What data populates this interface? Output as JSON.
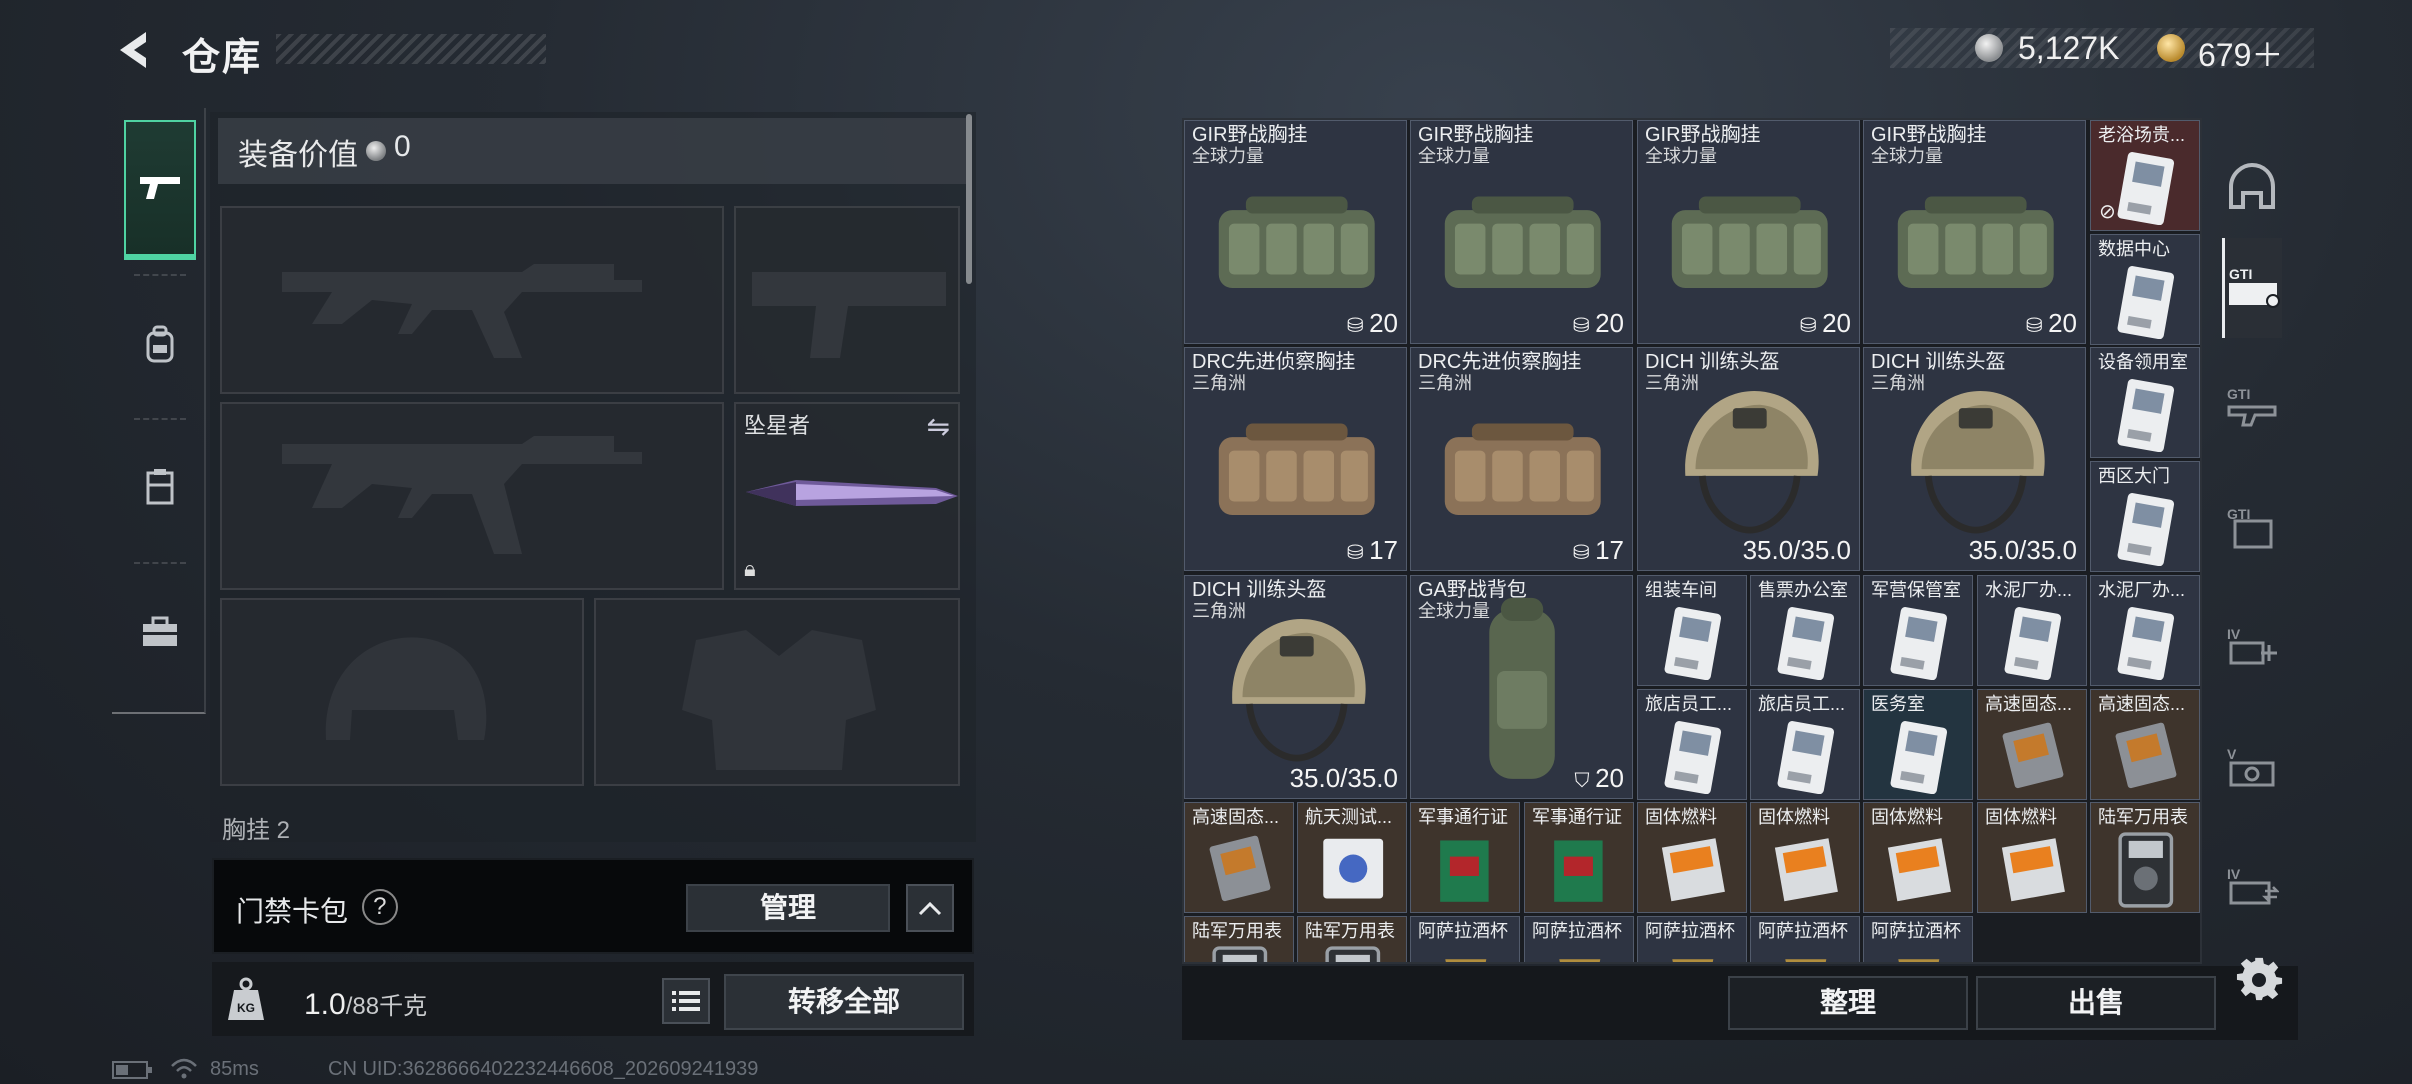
{
  "header": {
    "title": "仓库",
    "silver": "5,127K",
    "gold": "679＋"
  },
  "equipment": {
    "title": "装备价值",
    "value": "0",
    "melee_label": "坠星者",
    "next_section_label": "胸挂",
    "next_section_count": "2"
  },
  "card_pack": {
    "label": "门禁卡包",
    "help": "?",
    "manage_label": "管理"
  },
  "weight": {
    "current": "1.0",
    "max": "/88千克",
    "transfer_label": "转移全部"
  },
  "status": {
    "ping": "85ms",
    "uid": "CN UID:3628666402232446608_202609241939"
  },
  "storage": {
    "items": [
      {
        "name": "GIR野战胸挂",
        "sub": "全球力量",
        "count": "20",
        "count_icon": "vest",
        "art": "rig-green"
      },
      {
        "name": "GIR野战胸挂",
        "sub": "全球力量",
        "count": "20",
        "count_icon": "vest",
        "art": "rig-green"
      },
      {
        "name": "GIR野战胸挂",
        "sub": "全球力量",
        "count": "20",
        "count_icon": "vest",
        "art": "rig-green"
      },
      {
        "name": "GIR野战胸挂",
        "sub": "全球力量",
        "count": "20",
        "count_icon": "vest",
        "art": "rig-green"
      },
      {
        "name": "老浴场贵...",
        "sub": "",
        "count": "",
        "art": "card-red"
      },
      {
        "name": "数据中心",
        "sub": "",
        "count": "",
        "art": "card"
      },
      {
        "name": "DRC先进侦察胸挂",
        "sub": "三角洲",
        "count": "17",
        "count_icon": "vest",
        "art": "rig-tan"
      },
      {
        "name": "DRC先进侦察胸挂",
        "sub": "三角洲",
        "count": "17",
        "count_icon": "vest",
        "art": "rig-tan"
      },
      {
        "name": "DICH 训练头盔",
        "sub": "三角洲",
        "count": "35.0/35.0",
        "art": "helmet"
      },
      {
        "name": "DICH 训练头盔",
        "sub": "三角洲",
        "count": "35.0/35.0",
        "art": "helmet"
      },
      {
        "name": "设备领用室",
        "sub": "",
        "count": "",
        "art": "card"
      },
      {
        "name": "西区大门",
        "sub": "",
        "count": "",
        "art": "card"
      },
      {
        "name": "DICH 训练头盔",
        "sub": "三角洲",
        "count": "35.0/35.0",
        "art": "helmet"
      },
      {
        "name": "GA野战背包",
        "sub": "全球力量",
        "count": "20",
        "count_icon": "bag",
        "art": "backpack"
      },
      {
        "name": "组装车间",
        "sub": "",
        "count": "",
        "art": "card"
      },
      {
        "name": "售票办公室",
        "sub": "",
        "count": "",
        "art": "card"
      },
      {
        "name": "军营保管室",
        "sub": "",
        "count": "",
        "art": "card"
      },
      {
        "name": "水泥厂办...",
        "sub": "",
        "count": "",
        "art": "card"
      },
      {
        "name": "水泥厂办...",
        "sub": "",
        "count": "",
        "art": "card"
      },
      {
        "name": "旅店员工...",
        "sub": "",
        "count": "",
        "art": "card"
      },
      {
        "name": "旅店员工...",
        "sub": "",
        "count": "",
        "art": "card"
      },
      {
        "name": "医务室",
        "sub": "",
        "count": "",
        "art": "card-teal"
      },
      {
        "name": "高速固态...",
        "sub": "",
        "count": "",
        "art": "ssd"
      },
      {
        "name": "高速固态...",
        "sub": "",
        "count": "",
        "art": "ssd"
      },
      {
        "name": "高速固态...",
        "sub": "",
        "count": "",
        "art": "ssd"
      },
      {
        "name": "航天测试...",
        "sub": "",
        "count": "",
        "art": "disk"
      },
      {
        "name": "军事通行证",
        "sub": "",
        "count": "",
        "art": "pass"
      },
      {
        "name": "军事通行证",
        "sub": "",
        "count": "",
        "art": "pass"
      },
      {
        "name": "固体燃料",
        "sub": "",
        "count": "",
        "art": "fuel"
      },
      {
        "name": "固体燃料",
        "sub": "",
        "count": "",
        "art": "fuel"
      },
      {
        "name": "固体燃料",
        "sub": "",
        "count": "",
        "art": "fuel"
      },
      {
        "name": "固体燃料",
        "sub": "",
        "count": "",
        "art": "fuel"
      },
      {
        "name": "陆军万用表",
        "sub": "",
        "count": "",
        "art": "meter"
      },
      {
        "name": "陆军万用表",
        "sub": "",
        "count": "",
        "art": "meter"
      },
      {
        "name": "陆军万用表",
        "sub": "",
        "count": "",
        "art": "meter"
      },
      {
        "name": "阿萨拉酒杯",
        "sub": "",
        "count": "",
        "art": "cup"
      },
      {
        "name": "阿萨拉酒杯",
        "sub": "",
        "count": "",
        "art": "cup"
      },
      {
        "name": "阿萨拉酒杯",
        "sub": "",
        "count": "",
        "art": "cup"
      },
      {
        "name": "阿萨拉酒杯",
        "sub": "",
        "count": "",
        "art": "cup"
      },
      {
        "name": "阿萨拉酒杯",
        "sub": "",
        "count": "",
        "art": "cup"
      }
    ],
    "sort_label": "整理",
    "sell_label": "出售"
  },
  "side_tabs": [
    "helmet-tab-icon",
    "gti-card-tab-icon",
    "gti-weapon-tab-icon",
    "gti-case-tab-icon",
    "iv-add-tab-icon",
    "v-cam-tab-icon",
    "iv-swap-tab-icon"
  ]
}
